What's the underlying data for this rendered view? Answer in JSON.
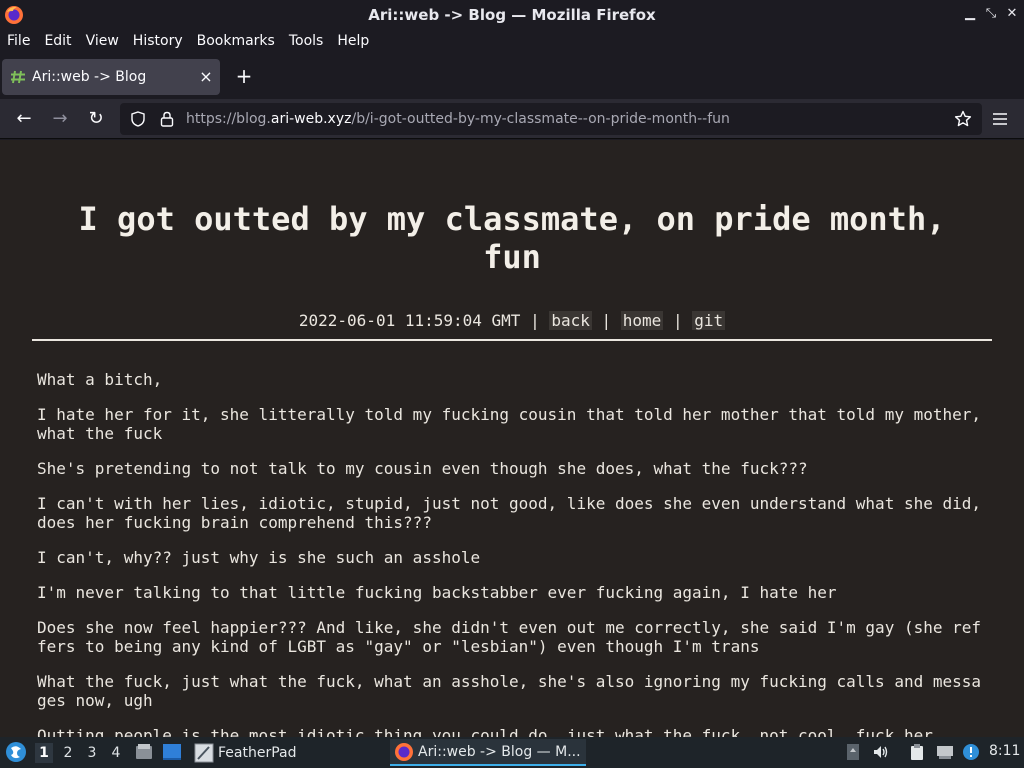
{
  "window": {
    "title": "Ari::web -> Blog — Mozilla Firefox",
    "icon": "firefox-icon"
  },
  "menu": [
    "File",
    "Edit",
    "View",
    "History",
    "Bookmarks",
    "Tools",
    "Help"
  ],
  "tab": {
    "label": "Ari::web -> Blog",
    "favicon": "hash-favicon",
    "close": "×",
    "newtab": "+"
  },
  "urlbar": {
    "prefix": "https://blog.",
    "host": "ari-web.xyz",
    "path": "/b/i-got-outted-by-my-classmate--on-pride-month--fun"
  },
  "post": {
    "title": "I got outted by my classmate, on pride month, fun",
    "date": "2022-06-01 11:59:04 GMT",
    "sep": " | ",
    "links": [
      "back",
      "home",
      "git"
    ],
    "paragraphs": [
      "What a bitch,",
      "I hate her for it, she litterally told my fucking cousin that told her mother that told my mother,\nwhat the fuck",
      "She's pretending to not talk to my cousin even though she does, what the fuck???",
      "I can't with her lies, idiotic, stupid, just not good, like does she even understand what she did,\ndoes her fucking brain comprehend this???",
      "I can't, why?? just why is she such an asshole",
      "I'm never talking to that little fucking backstabber ever fucking again, I hate her",
      "Does she now feel happier??? And like, she didn't even out me correctly, she said I'm gay (she ref\nfers to being any kind of LGBT as \"gay\" or \"lesbian\") even though I'm trans",
      "What the fuck, just what the fuck, what an asshole, she's also ignoring my fucking calls and messa\nges now, ugh",
      "Outting people is the most idiotic thing you could do, just what the fuck, not cool, fuck her"
    ]
  },
  "taskbar": {
    "workspaces": [
      "1",
      "2",
      "3",
      "4"
    ],
    "active_workspace": "1",
    "tasks": [
      "FeatherPad",
      "Ari::web -> Blog — M..."
    ],
    "clock": "8:11"
  },
  "colors": {
    "chrome_bg": "#1c1b22",
    "navbar_bg": "#2b2a33",
    "page_bg": "#262220",
    "text": "#eae6df",
    "taskbar_bg": "#1e2429",
    "accent": "#3daee9"
  }
}
